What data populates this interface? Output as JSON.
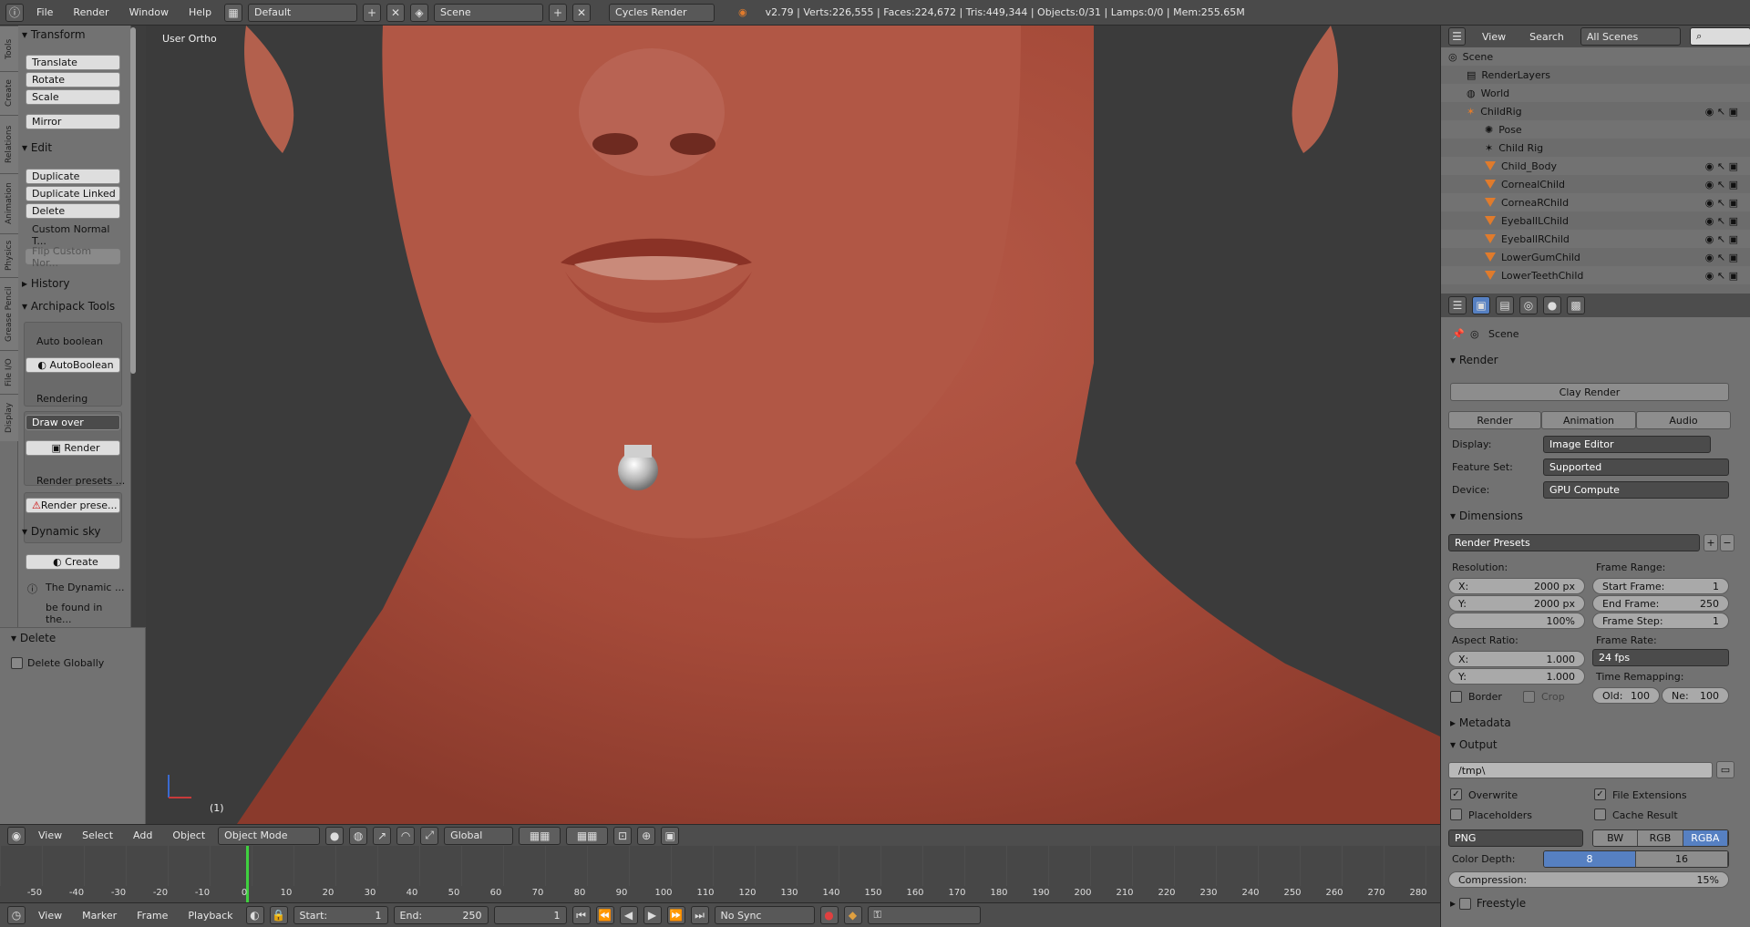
{
  "topbar": {
    "menus": [
      "File",
      "Render",
      "Window",
      "Help"
    ],
    "screen_layout": "Default",
    "scene": "Scene",
    "render_engine": "Cycles Render",
    "stats": "v2.79 | Verts:226,555 | Faces:224,672 | Tris:449,344 | Objects:0/31 | Lamps:0/0 | Mem:255.65M"
  },
  "vtabs": [
    "Tools",
    "Create",
    "Relations",
    "Animation",
    "Physics",
    "Grease Pencil",
    "File I/O",
    "Display"
  ],
  "toolshelf": {
    "transform": {
      "title": "Transform",
      "buttons": [
        "Translate",
        "Rotate",
        "Scale",
        "Mirror"
      ]
    },
    "edit": {
      "title": "Edit",
      "buttons": [
        "Duplicate",
        "Duplicate Linked",
        "Delete",
        "Custom Normal T...",
        "Flip Custom Nor..."
      ]
    },
    "history": "History",
    "archipack": {
      "title": "Archipack Tools",
      "auto_boolean_label": "Auto boolean",
      "auto_boolean_btn": "AutoBoolean",
      "rendering_label": "Rendering",
      "draw_over": "Draw over",
      "render_btn": "Render",
      "render_presets_label": "Render presets ...",
      "render_presets_btn": "Render prese..."
    },
    "dynamic_sky": {
      "title": "Dynamic sky",
      "create": "Create",
      "info1": "The Dynamic ...",
      "info2": "be found in the..."
    }
  },
  "delete_panel": {
    "title": "Delete",
    "option": "Delete Globally"
  },
  "viewport": {
    "title": "User Ortho",
    "frame": "(1)"
  },
  "vp_header": {
    "menus": [
      "View",
      "Select",
      "Add",
      "Object"
    ],
    "mode": "Object Mode",
    "orientation": "Global"
  },
  "timeline": {
    "ticks": [
      "-50",
      "-40",
      "-30",
      "-20",
      "-10",
      "0",
      "10",
      "20",
      "30",
      "40",
      "50",
      "60",
      "70",
      "80",
      "90",
      "100",
      "110",
      "120",
      "130",
      "140",
      "150",
      "160",
      "170",
      "180",
      "190",
      "200",
      "210",
      "220",
      "230",
      "240",
      "250",
      "260",
      "270",
      "280"
    ],
    "menus": [
      "View",
      "Marker",
      "Frame",
      "Playback"
    ],
    "start": "Start:",
    "start_val": "1",
    "end": "End:",
    "end_val": "250",
    "current": "1",
    "sync": "No Sync"
  },
  "outliner": {
    "menus": [
      "View",
      "Search"
    ],
    "filter": "All Scenes",
    "rows": [
      "Scene",
      "RenderLayers",
      "World",
      "ChildRig",
      "Pose",
      "Child Rig",
      "Child_Body",
      "CornealChild",
      "CorneaRChild",
      "EyeballLChild",
      "EyeballRChild",
      "LowerGumChild",
      "LowerTeethChild"
    ]
  },
  "properties": {
    "context": "Scene",
    "render_title": "Render",
    "clay_render": "Clay Render",
    "tabs": [
      "Render",
      "Animation",
      "Audio"
    ],
    "display_label": "Display:",
    "display_val": "Image Editor",
    "feature_label": "Feature Set:",
    "feature_val": "Supported",
    "device_label": "Device:",
    "device_val": "GPU Compute",
    "dimensions_title": "Dimensions",
    "render_presets": "Render Presets",
    "resolution_label": "Resolution:",
    "res_x_label": "X:",
    "res_x": "2000 px",
    "res_y_label": "Y:",
    "res_y": "2000 px",
    "res_pct": "100%",
    "frame_range_label": "Frame Range:",
    "start_frame_label": "Start Frame:",
    "start_frame": "1",
    "end_frame_label": "End Frame:",
    "end_frame": "250",
    "frame_step_label": "Frame Step:",
    "frame_step": "1",
    "aspect_label": "Aspect Ratio:",
    "aspect_x": "1.000",
    "aspect_y": "1.000",
    "frame_rate_label": "Frame Rate:",
    "frame_rate": "24 fps",
    "time_remap_label": "Time Remapping:",
    "old_label": "Old:",
    "old_val": "100",
    "new_label": "Ne:",
    "new_val": "100",
    "border": "Border",
    "crop": "Crop",
    "metadata_title": "Metadata",
    "output_title": "Output",
    "output_path": "/tmp\\",
    "overwrite": "Overwrite",
    "file_extensions": "File Extensions",
    "placeholders": "Placeholders",
    "cache_result": "Cache Result",
    "format": "PNG",
    "color_modes": [
      "BW",
      "RGB",
      "RGBA"
    ],
    "color_depth_label": "Color Depth:",
    "depths": [
      "8",
      "16"
    ],
    "compression_label": "Compression:",
    "compression": "15%",
    "freestyle_title": "Freestyle"
  }
}
